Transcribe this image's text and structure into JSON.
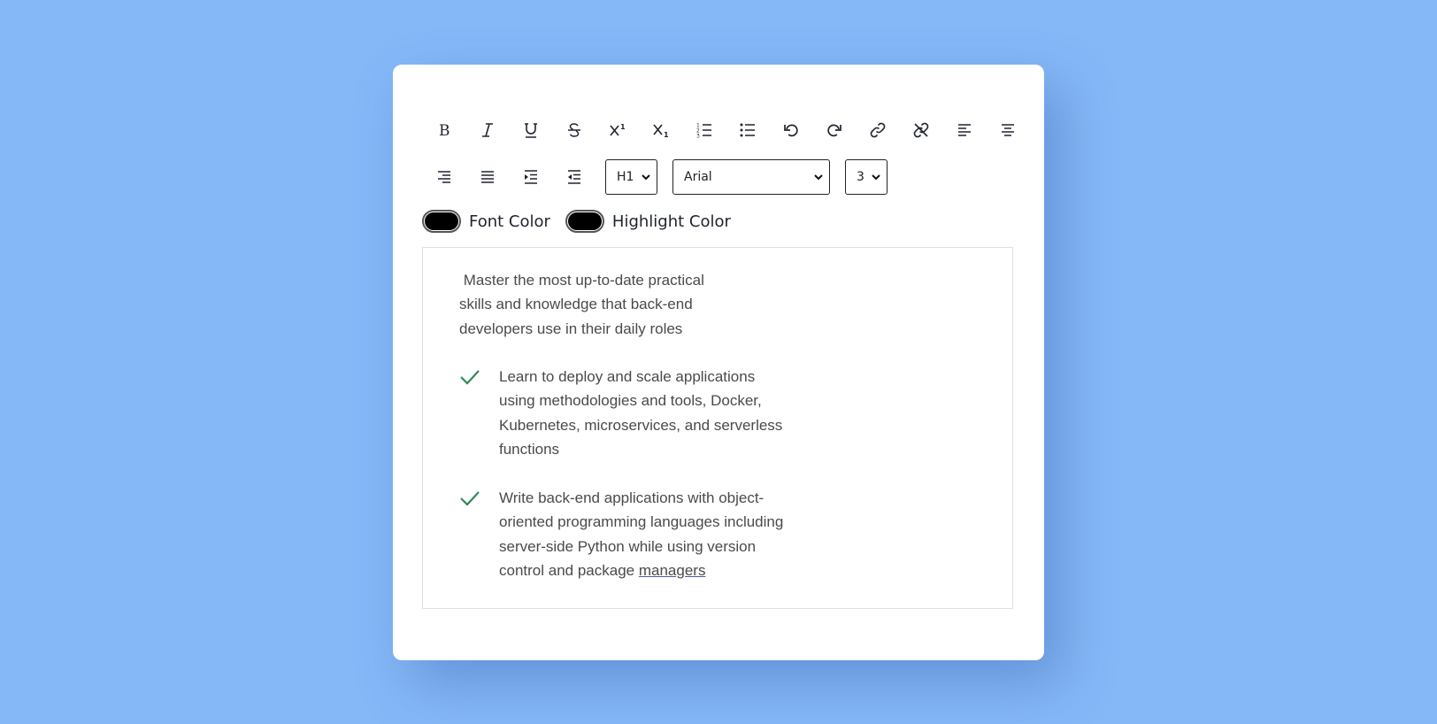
{
  "toolbar": {
    "row1": [
      {
        "name": "bold-button",
        "icon": "bold-icon"
      },
      {
        "name": "italic-button",
        "icon": "italic-icon"
      },
      {
        "name": "underline-button",
        "icon": "underline-icon"
      },
      {
        "name": "strikethrough-button",
        "icon": "strikethrough-icon"
      },
      {
        "name": "superscript-button",
        "icon": "superscript-icon"
      },
      {
        "name": "subscript-button",
        "icon": "subscript-icon"
      },
      {
        "name": "ordered-list-button",
        "icon": "ordered-list-icon"
      },
      {
        "name": "unordered-list-button",
        "icon": "unordered-list-icon"
      },
      {
        "name": "undo-button",
        "icon": "undo-icon"
      },
      {
        "name": "redo-button",
        "icon": "redo-icon"
      },
      {
        "name": "link-button",
        "icon": "link-icon"
      },
      {
        "name": "unlink-button",
        "icon": "unlink-icon"
      },
      {
        "name": "align-left-button",
        "icon": "align-left-icon"
      },
      {
        "name": "align-center-button",
        "icon": "align-center-icon"
      }
    ],
    "row2": [
      {
        "name": "align-right-button",
        "icon": "align-right-icon"
      },
      {
        "name": "justify-button",
        "icon": "justify-icon"
      },
      {
        "name": "indent-button",
        "icon": "indent-icon"
      },
      {
        "name": "outdent-button",
        "icon": "outdent-icon"
      }
    ],
    "heading_select": "H1",
    "font_select": "Arial",
    "size_select": "3"
  },
  "colors_controls": {
    "font_color_label": "Font Color",
    "font_color_value": "#000000",
    "highlight_color_label": "Highlight Color",
    "highlight_color_value": "#000000"
  },
  "editor": {
    "intro": " Master the most up-to-date practical skills and knowledge that back-end developers use in their daily roles",
    "bullets": [
      "Learn to deploy and scale applications using methodologies and tools, Docker, Kubernetes, microservices, and serverless functions",
      "Write back-end applications with object-oriented programming languages including server-side Python while using version control and package"
    ],
    "bullet2_link": "managers"
  },
  "theme": {
    "background": "#85b8f7",
    "check_color": "#2e8b57"
  }
}
